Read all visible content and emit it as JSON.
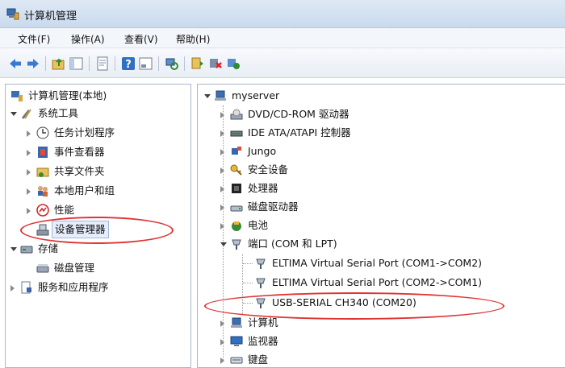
{
  "window": {
    "title": "计算机管理"
  },
  "menu": [
    {
      "label": "文件(F)"
    },
    {
      "label": "操作(A)"
    },
    {
      "label": "查看(V)"
    },
    {
      "label": "帮助(H)"
    }
  ],
  "toolbar": {
    "icons": [
      "back-arrow-icon",
      "forward-arrow-icon",
      "up-folder-icon",
      "show-tree-icon",
      "properties-icon",
      "help-icon",
      "console-tree-icon",
      "scan-hardware-icon",
      "update-driver-icon",
      "uninstall-icon",
      "disable-device-icon"
    ]
  },
  "left_tree": {
    "root": "计算机管理(本地)",
    "system_tools": "系统工具",
    "task_scheduler": "任务计划程序",
    "event_viewer": "事件查看器",
    "shared_folders": "共享文件夹",
    "local_users": "本地用户和组",
    "performance": "性能",
    "device_manager": "设备管理器",
    "storage": "存储",
    "disk_management": "磁盘管理",
    "services_apps": "服务和应用程序"
  },
  "device_tree": {
    "root": "myserver",
    "dvd": "DVD/CD-ROM 驱动器",
    "ide": "IDE ATA/ATAPI 控制器",
    "jungo": "Jungo",
    "security": "安全设备",
    "processor": "处理器",
    "disk_drives": "磁盘驱动器",
    "battery": "电池",
    "ports": "端口 (COM 和 LPT)",
    "port1": "ELTIMA Virtual Serial Port (COM1->COM2)",
    "port2": "ELTIMA Virtual Serial Port (COM2->COM1)",
    "port3": "USB-SERIAL CH340 (COM20)",
    "computer": "计算机",
    "monitor": "监视器",
    "keyboard": "键盘"
  }
}
